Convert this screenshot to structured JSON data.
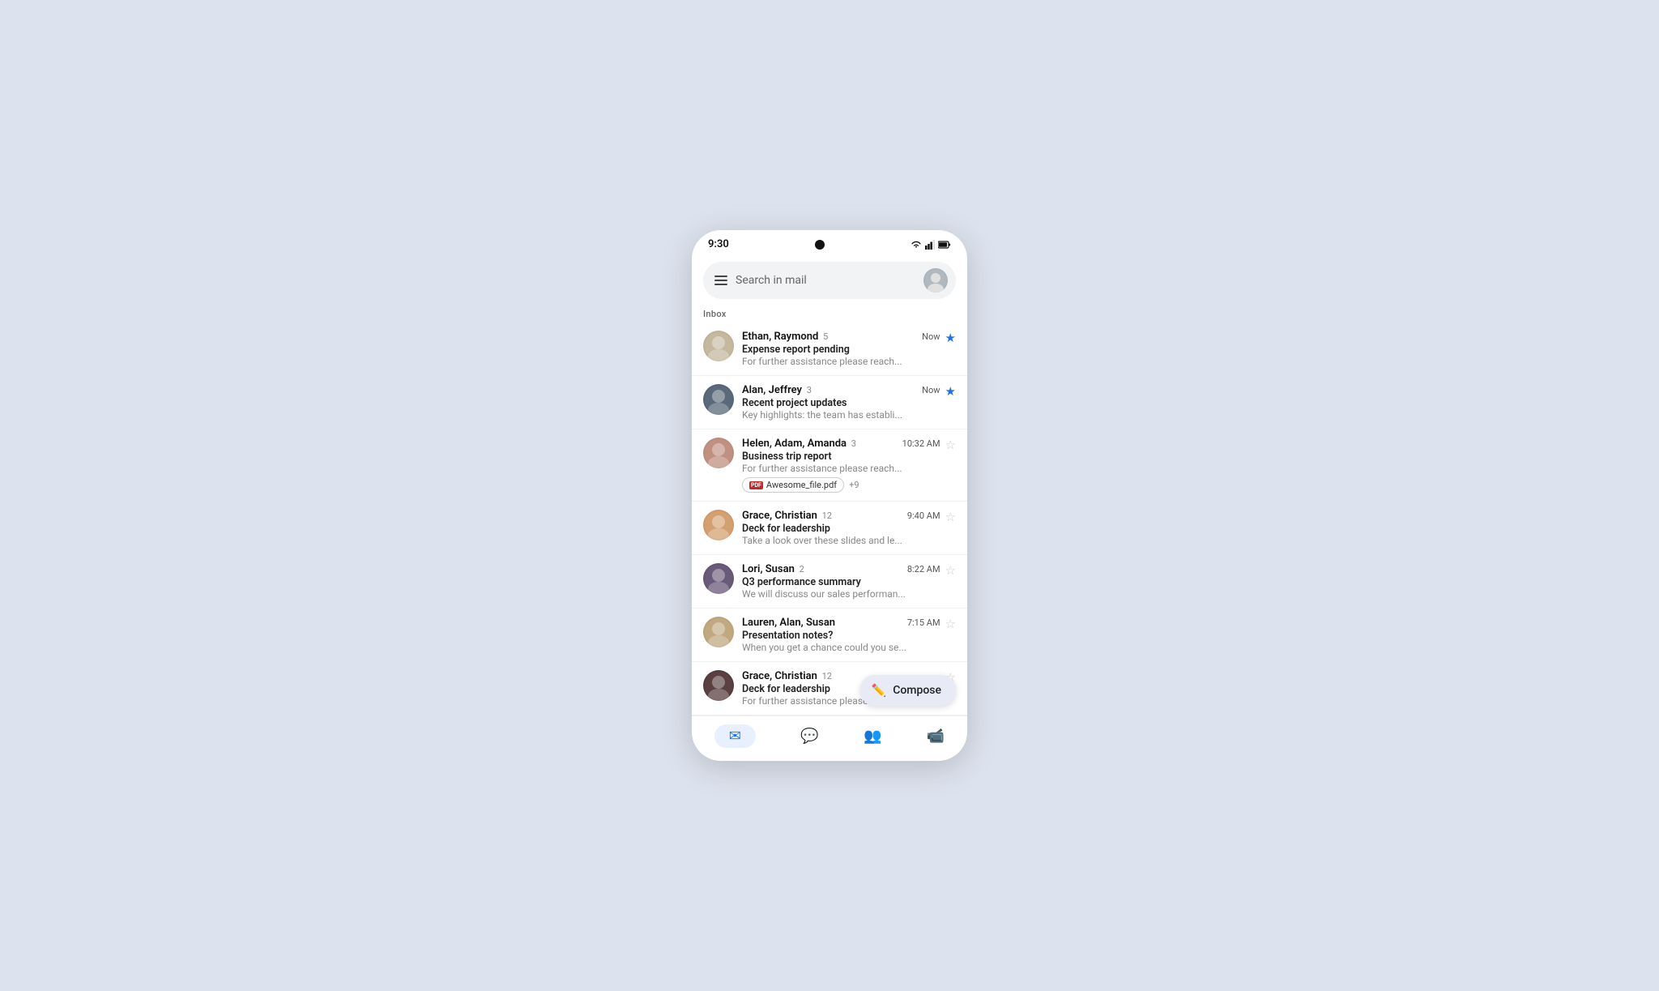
{
  "statusBar": {
    "time": "9:30"
  },
  "searchBar": {
    "placeholder": "Search in mail"
  },
  "inboxLabel": "Inbox",
  "emails": [
    {
      "id": "1",
      "sender": "Ethan, Raymond",
      "count": 5,
      "time": "Now",
      "subject": "Expense report pending",
      "preview": "For further assistance please reach...",
      "starred": true,
      "avatarClass": "av-ethan"
    },
    {
      "id": "2",
      "sender": "Alan, Jeffrey",
      "count": 3,
      "time": "Now",
      "subject": "Recent project updates",
      "preview": "Key highlights: the team has establi...",
      "starred": true,
      "avatarClass": "av-alan"
    },
    {
      "id": "3",
      "sender": "Helen, Adam, Amanda",
      "count": 3,
      "time": "10:32 AM",
      "subject": "Business trip report",
      "preview": "For further assistance please reach...",
      "starred": false,
      "avatarClass": "av-helen",
      "attachment": "Awesome_file.pdf",
      "extraAttachments": "+9"
    },
    {
      "id": "4",
      "sender": "Grace, Christian",
      "count": 12,
      "time": "9:40 AM",
      "subject": "Deck for leadership",
      "preview": "Take a look over these slides and le...",
      "starred": false,
      "avatarClass": "av-grace"
    },
    {
      "id": "5",
      "sender": "Lori, Susan",
      "count": 2,
      "time": "8:22 AM",
      "subject": "Q3 performance summary",
      "preview": "We will discuss our sales performan...",
      "starred": false,
      "avatarClass": "av-lori"
    },
    {
      "id": "6",
      "sender": "Lauren, Alan, Susan",
      "count": null,
      "time": "7:15 AM",
      "subject": "Presentation notes?",
      "preview": "When you get a chance could you se...",
      "starred": false,
      "avatarClass": "av-lauren"
    },
    {
      "id": "7",
      "sender": "Grace, Christian",
      "count": 12,
      "time": "...",
      "subject": "Deck for leadership",
      "preview": "For further assistance please reach...",
      "starred": false,
      "avatarClass": "av-grace2"
    }
  ],
  "compose": {
    "label": "Compose"
  },
  "bottomNav": [
    {
      "id": "mail",
      "icon": "✉",
      "active": true
    },
    {
      "id": "chat",
      "icon": "💬",
      "active": false
    },
    {
      "id": "spaces",
      "icon": "👥",
      "active": false
    },
    {
      "id": "meet",
      "icon": "📹",
      "active": false
    }
  ]
}
